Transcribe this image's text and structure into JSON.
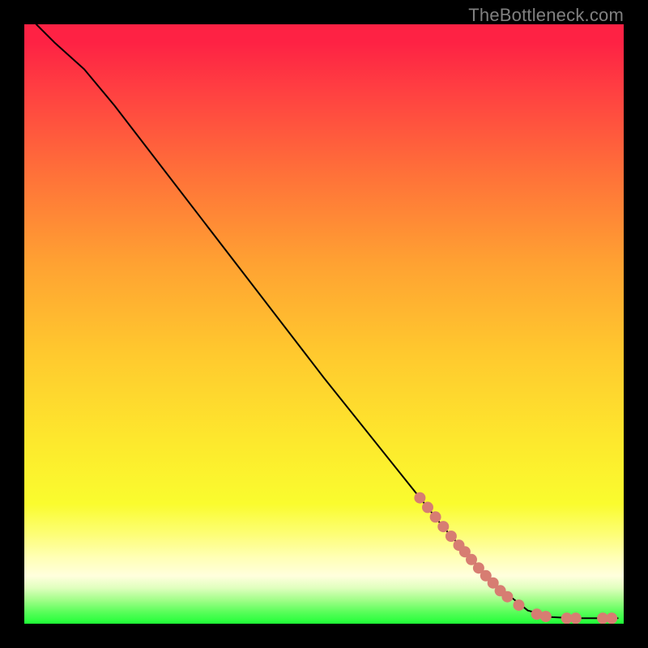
{
  "branding": "TheBottleneck.com",
  "chart_data": {
    "type": "line",
    "title": "",
    "xlabel": "",
    "ylabel": "",
    "xlim": [
      0,
      100
    ],
    "ylim": [
      0,
      100
    ],
    "grid": false,
    "legend": false,
    "curve": {
      "comment": "Percent coords (x right, y up). Steeply descending curve from top-left to bottom-right, flattening to ~0.",
      "points": [
        {
          "x": 2.0,
          "y": 100.0
        },
        {
          "x": 5.0,
          "y": 97.0
        },
        {
          "x": 10.0,
          "y": 92.5
        },
        {
          "x": 15.0,
          "y": 86.5
        },
        {
          "x": 20.0,
          "y": 80.0
        },
        {
          "x": 30.0,
          "y": 67.0
        },
        {
          "x": 40.0,
          "y": 54.0
        },
        {
          "x": 50.0,
          "y": 41.0
        },
        {
          "x": 60.0,
          "y": 28.5
        },
        {
          "x": 70.0,
          "y": 16.0
        },
        {
          "x": 78.0,
          "y": 7.0
        },
        {
          "x": 84.0,
          "y": 2.2
        },
        {
          "x": 88.0,
          "y": 1.1
        },
        {
          "x": 92.0,
          "y": 0.9
        },
        {
          "x": 96.0,
          "y": 0.9
        },
        {
          "x": 99.0,
          "y": 0.9
        }
      ]
    },
    "markers": {
      "comment": "Salmon dot markers clustered along the lower-right portion of the curve.",
      "color": "#d77d72",
      "radius_px": 7,
      "points": [
        {
          "x": 66.0,
          "y": 21.0
        },
        {
          "x": 67.3,
          "y": 19.4
        },
        {
          "x": 68.6,
          "y": 17.8
        },
        {
          "x": 69.9,
          "y": 16.2
        },
        {
          "x": 71.2,
          "y": 14.6
        },
        {
          "x": 72.5,
          "y": 13.1
        },
        {
          "x": 73.5,
          "y": 12.0
        },
        {
          "x": 74.6,
          "y": 10.7
        },
        {
          "x": 75.8,
          "y": 9.3
        },
        {
          "x": 77.0,
          "y": 8.0
        },
        {
          "x": 78.2,
          "y": 6.8
        },
        {
          "x": 79.4,
          "y": 5.5
        },
        {
          "x": 80.6,
          "y": 4.5
        },
        {
          "x": 82.5,
          "y": 3.1
        },
        {
          "x": 85.5,
          "y": 1.6
        },
        {
          "x": 87.0,
          "y": 1.2
        },
        {
          "x": 90.5,
          "y": 0.9
        },
        {
          "x": 92.0,
          "y": 0.9
        },
        {
          "x": 96.5,
          "y": 0.9
        },
        {
          "x": 98.0,
          "y": 0.9
        }
      ]
    }
  }
}
